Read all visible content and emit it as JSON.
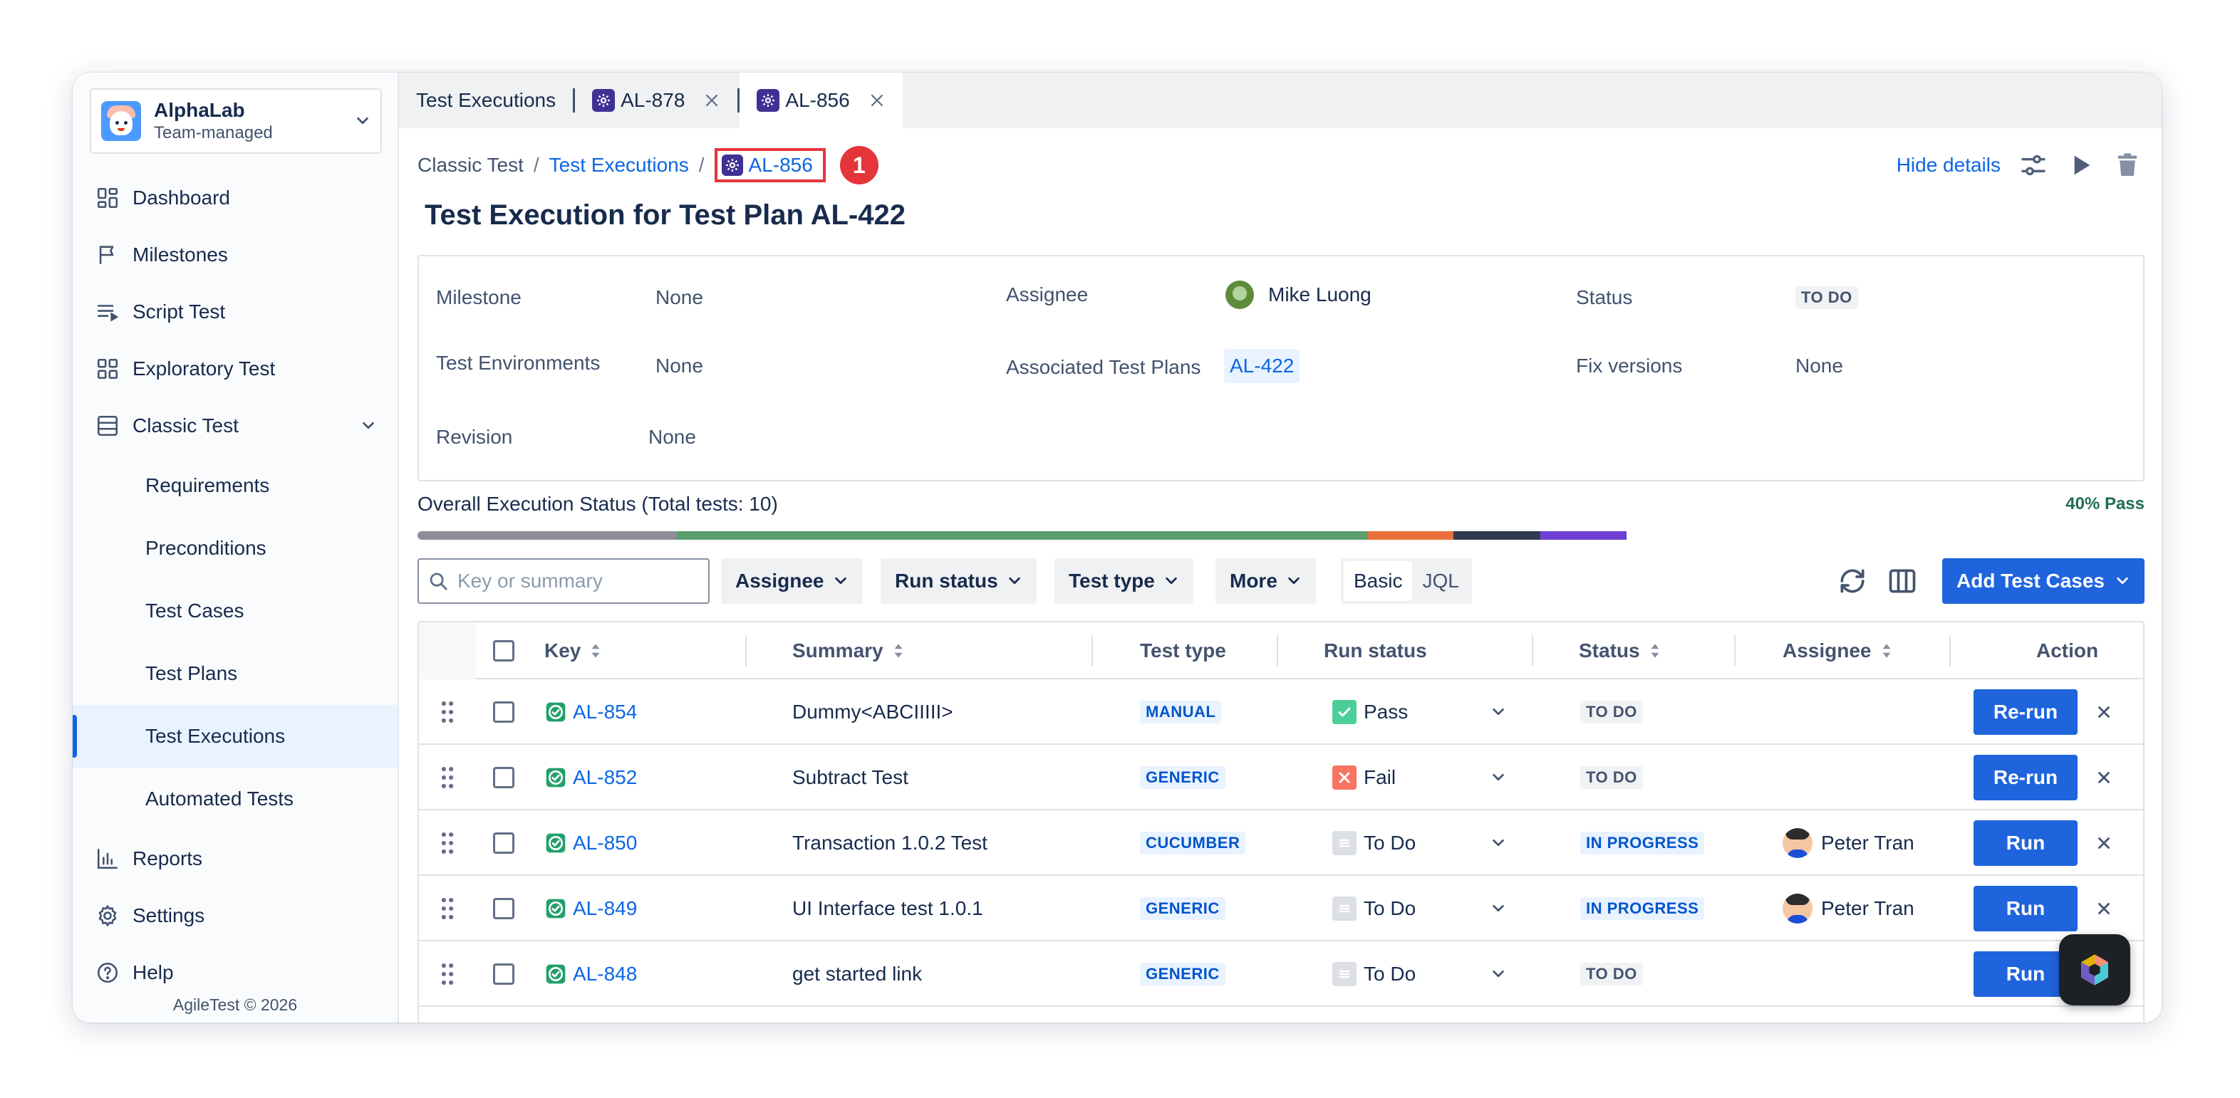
{
  "project": {
    "name": "AlphaLab",
    "type": "Team-managed"
  },
  "sidebar": {
    "items": [
      {
        "label": "Dashboard",
        "icon": "dashboard-icon"
      },
      {
        "label": "Milestones",
        "icon": "flag-icon"
      },
      {
        "label": "Script Test",
        "icon": "script-icon"
      },
      {
        "label": "Exploratory Test",
        "icon": "grid-icon"
      },
      {
        "label": "Classic Test",
        "icon": "table-icon"
      }
    ],
    "classic_sub": [
      "Requirements",
      "Preconditions",
      "Test Cases",
      "Test Plans",
      "Test Executions",
      "Automated Tests"
    ],
    "bottom_items": [
      {
        "label": "Reports",
        "icon": "chart-icon"
      },
      {
        "label": "Settings",
        "icon": "gear-icon"
      },
      {
        "label": "Help",
        "icon": "help-icon"
      }
    ],
    "copyright": "AgileTest © 2026"
  },
  "tabs": [
    {
      "label": "Test Executions"
    },
    {
      "label": "AL-878"
    },
    {
      "label": "AL-856"
    }
  ],
  "breadcrumb": {
    "root": "Classic Test",
    "sep": "/",
    "parent": "Test Executions",
    "current": "AL-856",
    "step_badge": "1"
  },
  "header": {
    "hide_details": "Hide details",
    "title": "Test Execution for Test Plan AL-422"
  },
  "details": {
    "milestone_label": "Milestone",
    "milestone_value": "None",
    "env_label": "Test Environments",
    "env_value": "None",
    "revision_label": "Revision",
    "revision_value": "None",
    "assignee_label": "Assignee",
    "assignee_value": "Mike Luong",
    "plans_label": "Associated Test Plans",
    "plans_value": "AL-422",
    "status_label": "Status",
    "status_value": "TO DO",
    "fix_label": "Fix versions",
    "fix_value": "None"
  },
  "overall": {
    "label": "Overall Execution Status (Total tests: 10)",
    "pass_label": "40% Pass",
    "segments": [
      {
        "fraction": 0.15,
        "color": "#8c8f97"
      },
      {
        "fraction": 0.2,
        "color": "#5b9f6e"
      },
      {
        "fraction": 0.2,
        "color": "#5b9f6e"
      },
      {
        "fraction": 0.05,
        "color": "#e8703a"
      },
      {
        "fraction": 0.05,
        "color": "#2f3b4f"
      },
      {
        "fraction": 0.05,
        "color": "#6e3fd4"
      }
    ]
  },
  "filters": {
    "search_placeholder": "Key or summary",
    "assignee": "Assignee",
    "run_status": "Run status",
    "test_type": "Test type",
    "more": "More",
    "basic": "Basic",
    "jql": "JQL",
    "add_test_cases": "Add Test Cases"
  },
  "table": {
    "headers": {
      "key": "Key",
      "summary": "Summary",
      "test_type": "Test type",
      "run_status": "Run status",
      "status": "Status",
      "assignee": "Assignee",
      "action": "Action"
    },
    "rows": [
      {
        "key": "AL-854",
        "summary": "Dummy<ABCIIIII>",
        "type": "MANUAL",
        "run": "Pass",
        "run_kind": "pass",
        "status": "TO DO",
        "status_kind": "todo",
        "assignee": "",
        "action": "Re-run"
      },
      {
        "key": "AL-852",
        "summary": "Subtract Test",
        "type": "GENERIC",
        "run": "Fail",
        "run_kind": "fail",
        "status": "TO DO",
        "status_kind": "todo",
        "assignee": "",
        "action": "Re-run"
      },
      {
        "key": "AL-850",
        "summary": "Transaction 1.0.2 Test",
        "type": "CUCUMBER",
        "run": "To Do",
        "run_kind": "todo",
        "status": "IN PROGRESS",
        "status_kind": "progress",
        "assignee": "Peter Tran",
        "action": "Run"
      },
      {
        "key": "AL-849",
        "summary": "UI Interface test 1.0.1",
        "type": "GENERIC",
        "run": "To Do",
        "run_kind": "todo",
        "status": "IN PROGRESS",
        "status_kind": "progress",
        "assignee": "Peter Tran",
        "action": "Run"
      },
      {
        "key": "AL-848",
        "summary": "get started link",
        "type": "GENERIC",
        "run": "To Do",
        "run_kind": "todo",
        "status": "TO DO",
        "status_kind": "todo",
        "assignee": "",
        "action": "Run"
      }
    ]
  }
}
